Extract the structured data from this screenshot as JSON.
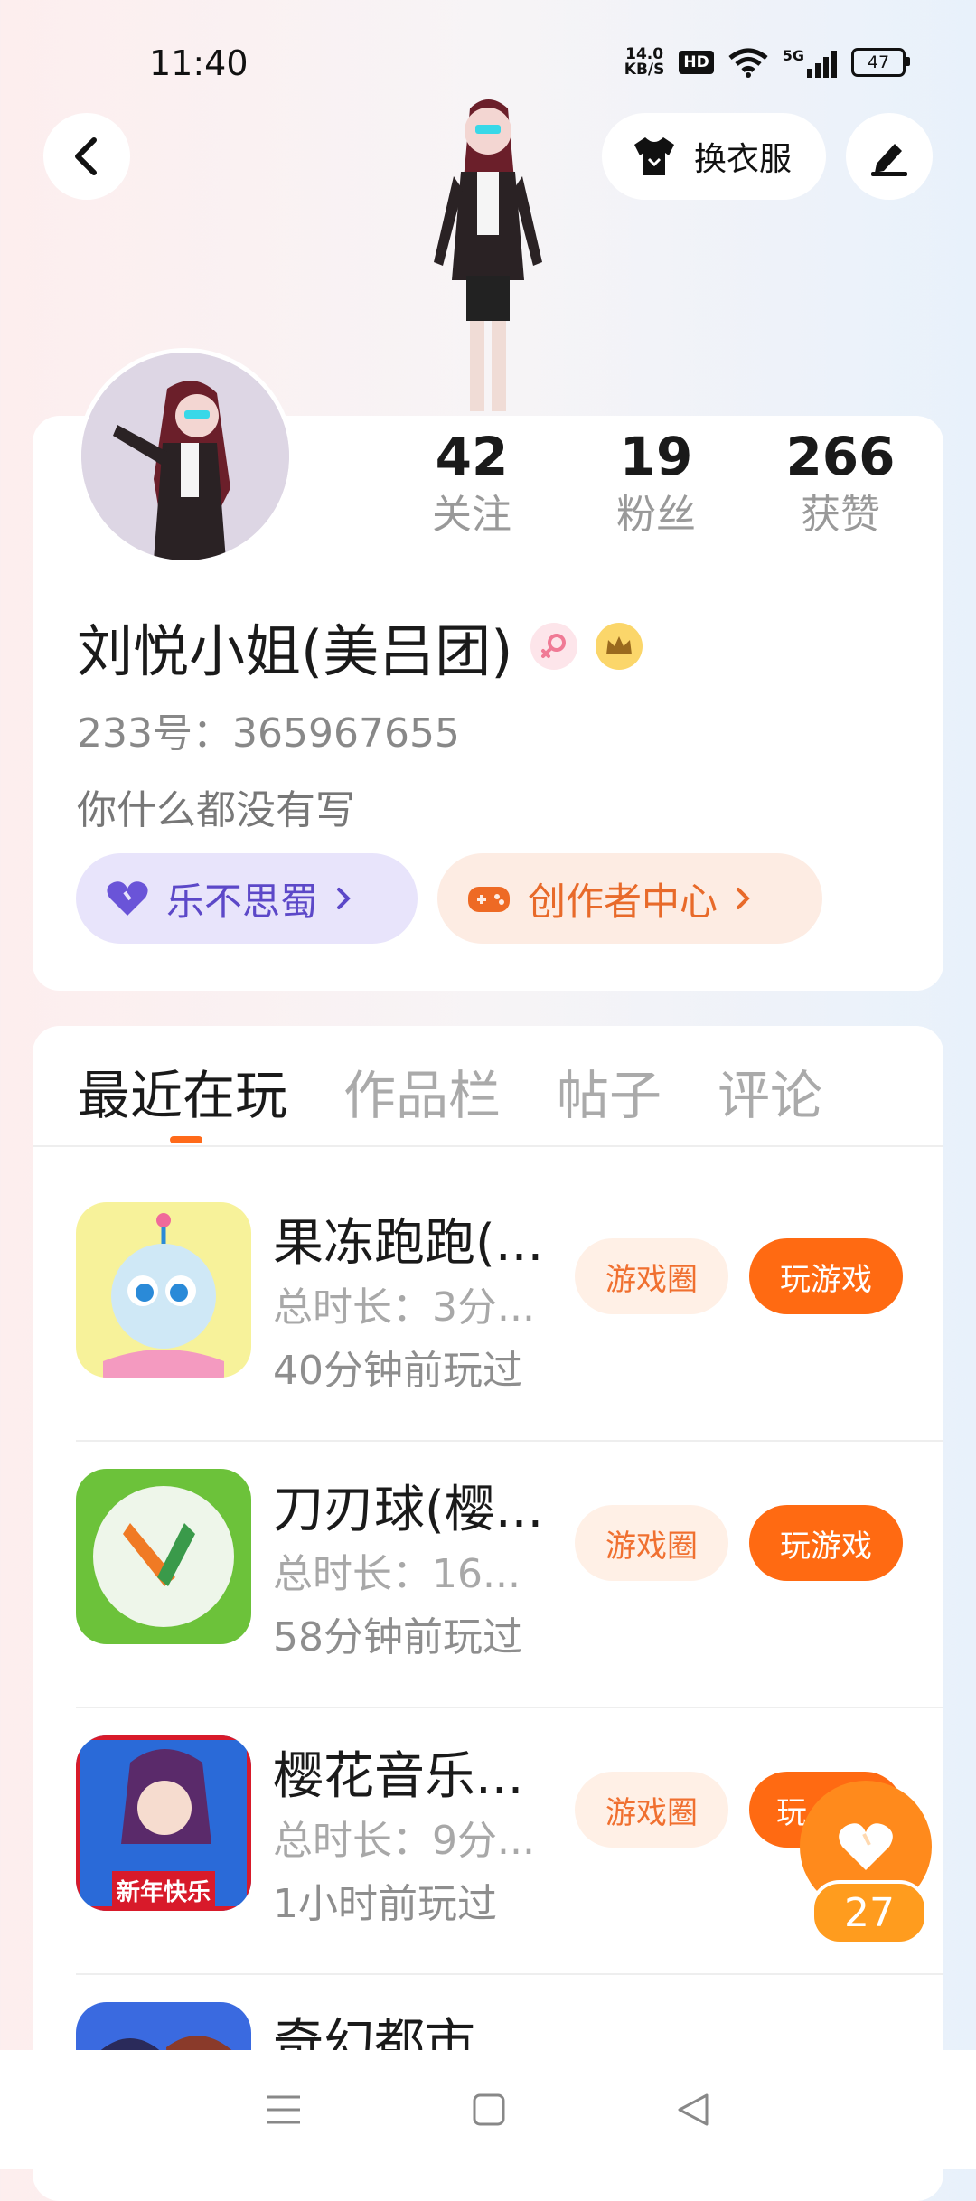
{
  "status": {
    "time": "11:40",
    "net_speed_top": "14.0",
    "net_speed_bottom": "KB/S",
    "hd": "HD",
    "signal": "5G",
    "battery": "47"
  },
  "header": {
    "outfit_label": "换衣服"
  },
  "profile": {
    "stats": [
      {
        "value": "42",
        "label": "关注"
      },
      {
        "value": "19",
        "label": "粉丝"
      },
      {
        "value": "266",
        "label": "获赞"
      }
    ],
    "name": "刘悦小姐(美吕团)",
    "id_line": "233号：365967655",
    "bio": "你什么都没有写",
    "chip_guild": "乐不思蜀",
    "chip_creator": "创作者中心"
  },
  "tabs": [
    {
      "label": "最近在玩",
      "active": true
    },
    {
      "label": "作品栏",
      "active": false
    },
    {
      "label": "帖子",
      "active": false
    },
    {
      "label": "评论",
      "active": false
    }
  ],
  "games": [
    {
      "title": "果冻跑跑(...",
      "duration": "总时长：3分...",
      "last_played": "40分钟前玩过",
      "circle_label": "游戏圈",
      "play_label": "玩游戏"
    },
    {
      "title": "刀刃球(樱...",
      "duration": "总时长：16...",
      "last_played": "58分钟前玩过",
      "circle_label": "游戏圈",
      "play_label": "玩游戏"
    },
    {
      "title": "樱花音乐...",
      "duration": "总时长：9分...",
      "last_played": "1小时前玩过",
      "circle_label": "游戏圈",
      "play_label": "玩"
    },
    {
      "title": "奇幻都市",
      "duration": "",
      "last_played": "",
      "circle_label": "",
      "play_label": ""
    }
  ],
  "game3_icon_text": "新年快乐",
  "like_fab": {
    "count": "27"
  },
  "colors": {
    "accent": "#ff6a12",
    "guild_chip_bg": "#e8e4fb",
    "creator_chip_bg": "#fdece3"
  }
}
